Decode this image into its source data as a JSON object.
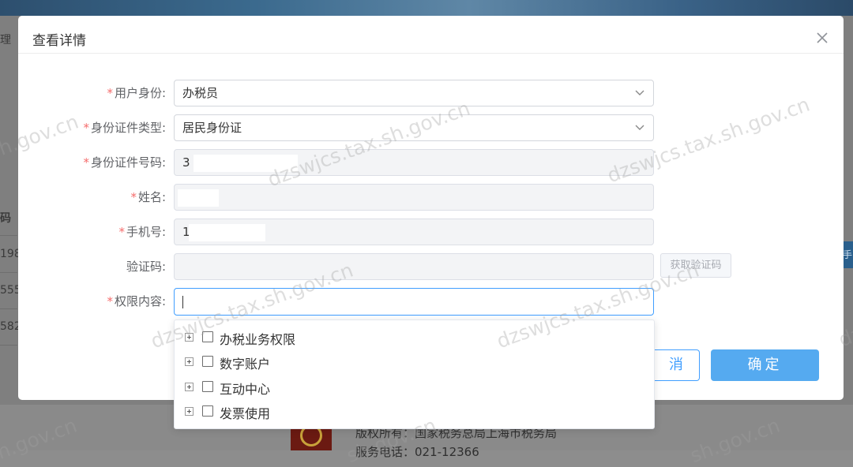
{
  "background": {
    "left_texts": [
      "理",
      "码",
      "198",
      "555",
      "582"
    ],
    "right_button": "手",
    "footer": {
      "line1": "版权所有：国家税务总局上海市税务局",
      "line2": "服务电话：021-12366"
    }
  },
  "watermark": {
    "text_full": "dzswjcs.tax.sh.gov.cn",
    "text_partial": "sh.gov.cn",
    "text_tail": "dz",
    "color": "#a0a0a0"
  },
  "dialog": {
    "title": "查看详情",
    "close_icon": "close-icon",
    "fields": {
      "user_identity": {
        "required": "*",
        "label": "用户身份:",
        "value": "办税员"
      },
      "id_type": {
        "required": "*",
        "label": "身份证件类型:",
        "value": "居民身份证"
      },
      "id_number": {
        "required": "*",
        "label": "身份证件号码:",
        "value": "3"
      },
      "name": {
        "required": "*",
        "label": "姓名:",
        "value": ""
      },
      "phone": {
        "required": "*",
        "label": "手机号:",
        "value": "1"
      },
      "verification_code": {
        "label": "验证码:",
        "value": "",
        "button": "获取验证码"
      },
      "permissions": {
        "required": "*",
        "label": "权限内容:",
        "value": ""
      }
    },
    "permission_tree": [
      {
        "label": "办税业务权限",
        "checked": false
      },
      {
        "label": "数字账户",
        "checked": false
      },
      {
        "label": "互动中心",
        "checked": false
      },
      {
        "label": "发票使用",
        "checked": false
      }
    ],
    "buttons": {
      "cancel": "取消",
      "cancel_visible": "消",
      "confirm": "确定"
    }
  },
  "colors": {
    "primary": "#409eff",
    "confirm_bg": "#55aaf0",
    "required": "#f56c6c"
  }
}
